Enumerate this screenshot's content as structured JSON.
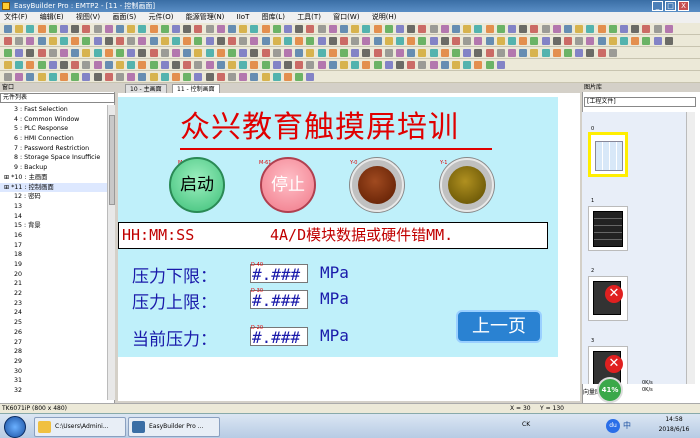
{
  "window": {
    "title": "EasyBuilder Pro : EMTP2 - [11 - 控制画面]",
    "controls": [
      "_",
      "□",
      "X"
    ]
  },
  "menu": [
    "文件(F)",
    "编辑(E)",
    "视图(V)",
    "画面(S)",
    "元件(O)",
    "能源管理(N)",
    "IIoT",
    "图库(L)",
    "工具(T)",
    "窗口(W)",
    "说明(H)"
  ],
  "left_panel": {
    "title": "窗口",
    "combo": "元件列表",
    "tree": [
      "3 : Fast Selection",
      "4 : Common Window",
      "5 : PLC Response",
      "6 : HMI Connection",
      "7 : Password Restriction",
      "8 : Storage Space Insufficie",
      "9 : Backup",
      "*10 : 主画面",
      "*11 : 控制画面",
      "12 : 密码",
      "13",
      "14",
      "15 : 背景",
      "16",
      "17",
      "18",
      "19",
      "20",
      "21",
      "22",
      "23",
      "24",
      "25",
      "26",
      "27",
      "28",
      "29",
      "30",
      "31",
      "32"
    ],
    "footer": "TK6071iP (800 x 480)"
  },
  "tabs": [
    "10 - 主画面",
    "11 - 控制画面"
  ],
  "hmi": {
    "title": "众兴教育触摸屏培训",
    "start_button": {
      "label": "启动",
      "tag": "M-60"
    },
    "stop_button": {
      "label": "停止",
      "tag": "M-61"
    },
    "lamp1_tag": "Y-0",
    "lamp2_tag": "Y-1",
    "time_display": "HH:MM:SS",
    "alarm_text": "4A/D模块数据或硬件错MM.",
    "rows": [
      {
        "label": "压力下限：",
        "value": "#.###",
        "unit": "MPa",
        "tag": "D-40"
      },
      {
        "label": "压力上限：",
        "value": "#.###",
        "unit": "MPa",
        "tag": "D-30"
      },
      {
        "label": "当前压力：",
        "value": "#.###",
        "unit": "MPa",
        "tag": "D-20"
      }
    ],
    "prev_button": "上一页",
    "colors": {
      "title": "#e00000",
      "background": "#bff0fa",
      "text": "#1a1aaa",
      "start": "#55cc88",
      "stop": "#ff8899",
      "prev": "#2a82d2"
    }
  },
  "right_panel": {
    "title": "图片库",
    "combo": "[工程文件]",
    "items": [
      "0",
      "1",
      "2",
      "3"
    ],
    "bottom_label": "向量图库"
  },
  "status": {
    "x": "X = 30",
    "y": "Y = 130"
  },
  "taskbar": {
    "items": [
      "C:\\Users\\Admini...",
      "EasyBuilder Pro ..."
    ],
    "tray": {
      "cpu": "41%",
      "net_up": "0K/s",
      "net_down": "0K/s",
      "lang": "CK",
      "time": "14:58",
      "date": "2018/6/16",
      "ime": "中"
    }
  }
}
